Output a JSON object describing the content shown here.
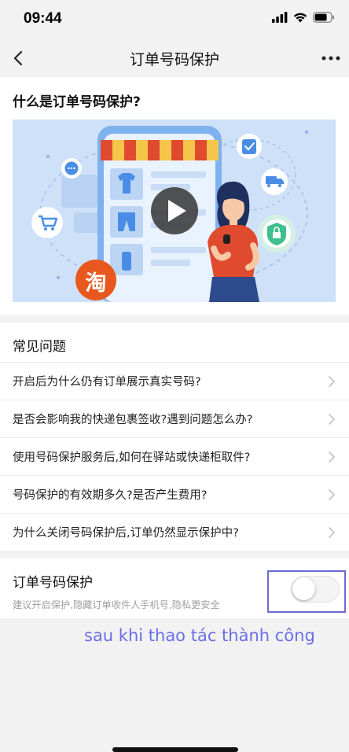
{
  "status_bar": {
    "time": "09:44"
  },
  "nav": {
    "title": "订单号码保护"
  },
  "intro": {
    "heading": "什么是订单号码保护?",
    "banner_logo_char": "淘"
  },
  "faq": {
    "heading": "常见问题",
    "items": [
      {
        "label": "开启后为什么仍有订单展示真实号码?"
      },
      {
        "label": "是否会影响我的快递包裹签收?遇到问题怎么办?"
      },
      {
        "label": "使用号码保护服务后,如何在驿站或快递柜取件?"
      },
      {
        "label": "号码保护的有效期多久?是否产生费用?"
      },
      {
        "label": "为什么关闭号码保护后,订单仍然显示保护中?"
      }
    ]
  },
  "protection": {
    "title": "订单号码保护",
    "description": "建议开启保护,隐藏订单收件人手机号,隐私更安全",
    "toggle_on": false
  },
  "caption": "sau khi thao tác thành công",
  "colors": {
    "accent_caption": "#6a6ee6",
    "highlight_border": "#6b6bd6",
    "banner_bg": "#cfe1f8",
    "awning_red": "#e04a2f",
    "awning_yellow": "#f5c64a"
  }
}
